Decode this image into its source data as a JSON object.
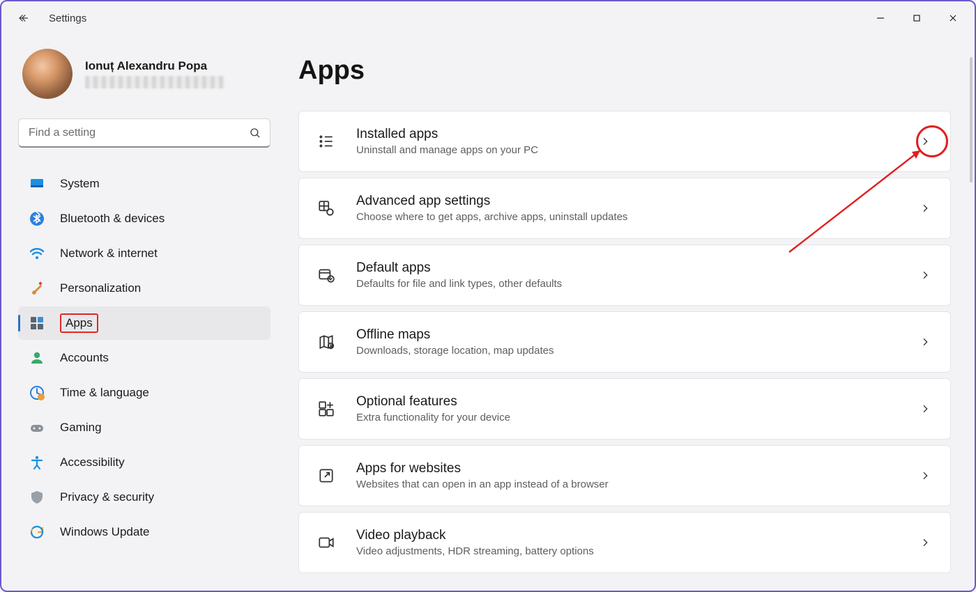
{
  "window": {
    "title": "Settings"
  },
  "profile": {
    "name": "Ionuț Alexandru Popa"
  },
  "search": {
    "placeholder": "Find a setting"
  },
  "sidebar": {
    "items": [
      {
        "id": "system",
        "label": "System",
        "active": false
      },
      {
        "id": "bluetooth",
        "label": "Bluetooth & devices",
        "active": false
      },
      {
        "id": "network",
        "label": "Network & internet",
        "active": false
      },
      {
        "id": "personalization",
        "label": "Personalization",
        "active": false
      },
      {
        "id": "apps",
        "label": "Apps",
        "active": true
      },
      {
        "id": "accounts",
        "label": "Accounts",
        "active": false
      },
      {
        "id": "time",
        "label": "Time & language",
        "active": false
      },
      {
        "id": "gaming",
        "label": "Gaming",
        "active": false
      },
      {
        "id": "accessibility",
        "label": "Accessibility",
        "active": false
      },
      {
        "id": "privacy",
        "label": "Privacy & security",
        "active": false
      },
      {
        "id": "update",
        "label": "Windows Update",
        "active": false
      }
    ]
  },
  "page": {
    "heading": "Apps",
    "cards": [
      {
        "id": "installed",
        "title": "Installed apps",
        "desc": "Uninstall and manage apps on your PC"
      },
      {
        "id": "advanced",
        "title": "Advanced app settings",
        "desc": "Choose where to get apps, archive apps, uninstall updates"
      },
      {
        "id": "default",
        "title": "Default apps",
        "desc": "Defaults for file and link types, other defaults"
      },
      {
        "id": "maps",
        "title": "Offline maps",
        "desc": "Downloads, storage location, map updates"
      },
      {
        "id": "optional",
        "title": "Optional features",
        "desc": "Extra functionality for your device"
      },
      {
        "id": "websites",
        "title": "Apps for websites",
        "desc": "Websites that can open in an app instead of a browser"
      },
      {
        "id": "video",
        "title": "Video playback",
        "desc": "Video adjustments, HDR streaming, battery options"
      }
    ]
  }
}
